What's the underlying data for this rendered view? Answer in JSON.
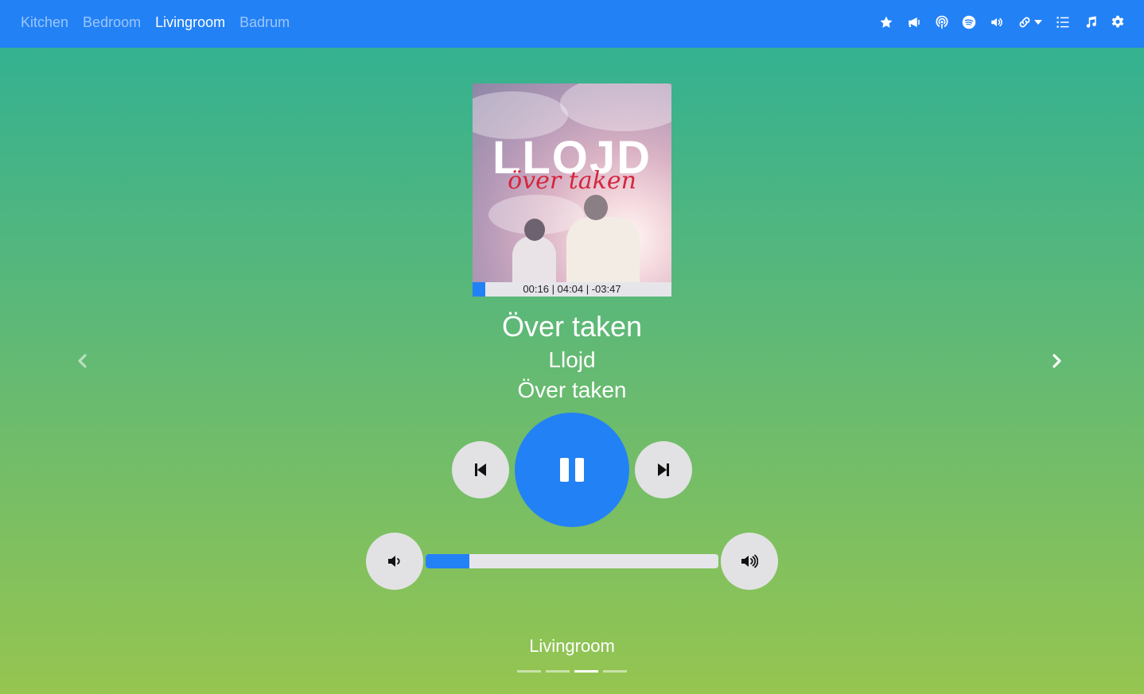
{
  "navbar": {
    "rooms": [
      "Kitchen",
      "Bedroom",
      "Livingroom",
      "Badrum"
    ],
    "active_room": "Livingroom",
    "icons": [
      "star-icon",
      "bullhorn-icon",
      "podcast-icon",
      "spotify-icon",
      "volume-icon",
      "link-icon",
      "list-icon",
      "music-icon",
      "gear-icon"
    ],
    "accent_color": "#2381f6"
  },
  "album": {
    "cover_title": "LLOJD",
    "cover_subtitle": "över taken"
  },
  "progress": {
    "time_text": "00:16 | 04:04 | -03:47",
    "elapsed_fraction": 0.065
  },
  "track": {
    "title": "Över taken",
    "artist": "Llojd",
    "album": "Över taken"
  },
  "controls": {
    "icons": [
      "step-backward-icon",
      "pause-icon",
      "step-forward-icon",
      "volume-down-icon",
      "volume-up-icon",
      "chevron-left-icon",
      "chevron-right-icon"
    ]
  },
  "volume": {
    "level_fraction": 0.15
  },
  "footer": {
    "current_room": "Livingroom",
    "slide_count": 4,
    "active_slide": 2
  }
}
